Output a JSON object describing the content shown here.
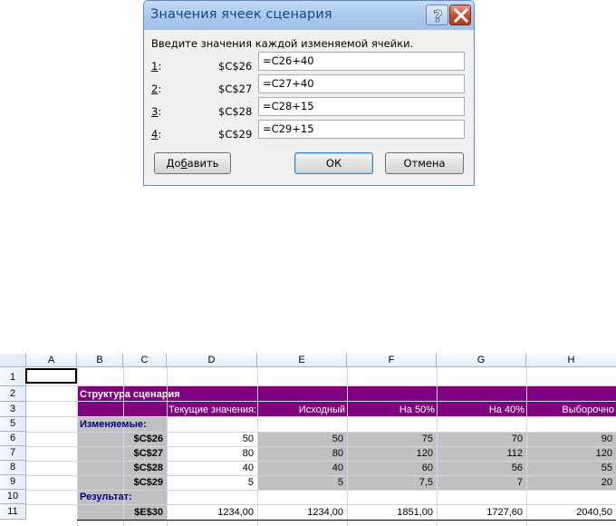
{
  "dialog": {
    "title": "Значения ячеек сценария",
    "instruction": "Введите значения каждой изменяемой ячейки.",
    "rows": [
      {
        "num": "1",
        "suffix": ":",
        "cell": "$C$26",
        "value": "=C26+40"
      },
      {
        "num": "2",
        "suffix": ":",
        "cell": "$C$27",
        "value": "=C27+40"
      },
      {
        "num": "3",
        "suffix": ":",
        "cell": "$C$28",
        "value": "=C28+15"
      },
      {
        "num": "4",
        "suffix": ":",
        "cell": "$C$29",
        "value": "=C29+15"
      }
    ],
    "add_button": {
      "pre": "До",
      "accel": "б",
      "post": "авить"
    },
    "ok_button": "ОК",
    "cancel_button": "Отмена",
    "help_icon": "question-mark-icon",
    "close_icon": "close-x-icon"
  },
  "sheet": {
    "columns": [
      "A",
      "B",
      "C",
      "D",
      "E",
      "F",
      "G",
      "H"
    ],
    "row_numbers": [
      "1",
      "2",
      "3",
      "5",
      "6",
      "7",
      "8",
      "9",
      "10",
      "11"
    ],
    "title": "Структура сценария",
    "headers": [
      "Текущие значения:",
      "Исходный",
      "На 50%",
      "На 40%",
      "Выборочно"
    ],
    "changing_label": "Изменяемые:",
    "changing": [
      {
        "cell": "$C$26",
        "values": [
          "50",
          "50",
          "75",
          "70",
          "90"
        ]
      },
      {
        "cell": "$C$27",
        "values": [
          "80",
          "80",
          "120",
          "112",
          "120"
        ]
      },
      {
        "cell": "$C$28",
        "values": [
          "40",
          "40",
          "60",
          "56",
          "55"
        ]
      },
      {
        "cell": "$C$29",
        "values": [
          "5",
          "5",
          "7,5",
          "7",
          "20"
        ]
      }
    ],
    "result_label": "Результат:",
    "result": {
      "cell": "$E$30",
      "values": [
        "1234,00",
        "1234,00",
        "1851,00",
        "1727,60",
        "2040,50"
      ]
    },
    "colors": {
      "purple": "#800080",
      "gray": "#c0c0c0",
      "label_blue": "#000080"
    }
  }
}
